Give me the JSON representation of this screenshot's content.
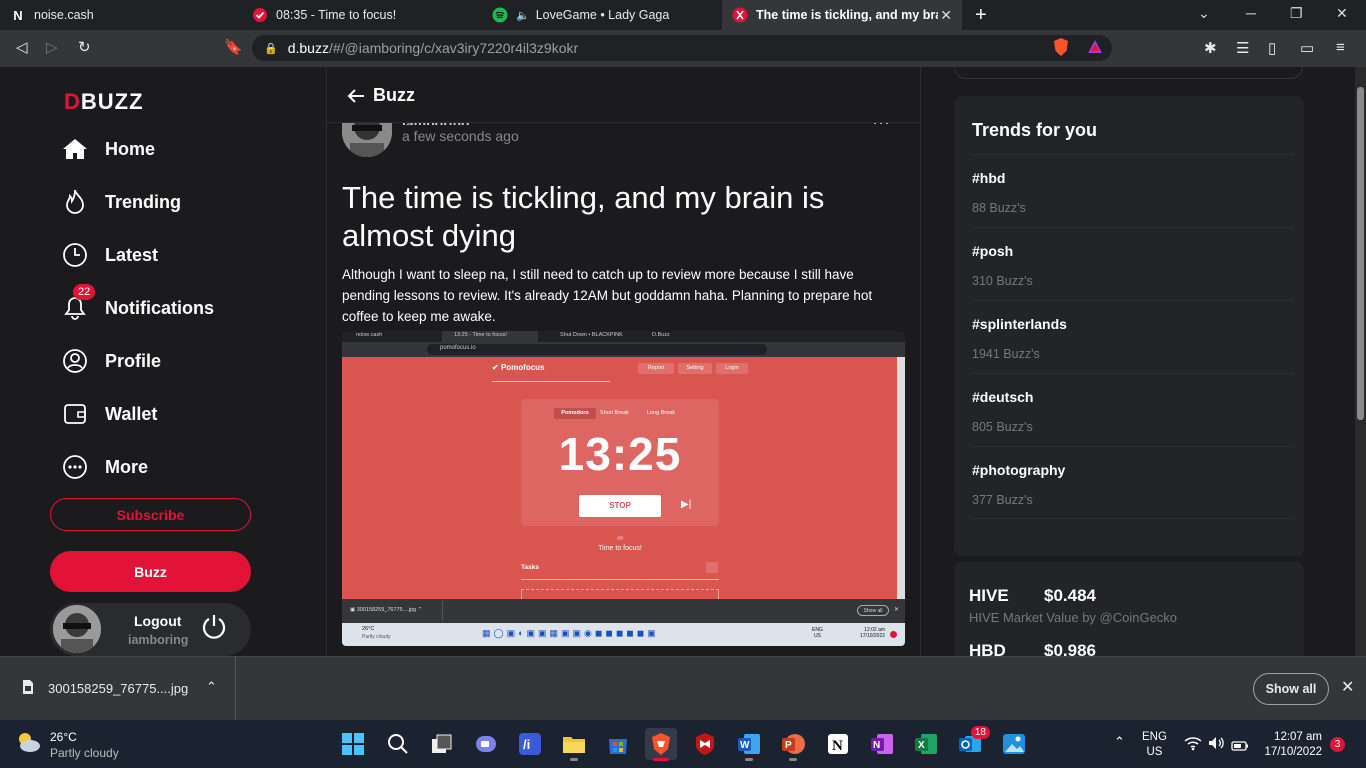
{
  "browser": {
    "tabs": [
      {
        "title": "noise.cash",
        "icon": "noise-cash-icon"
      },
      {
        "title": "08:35 - Time to focus!",
        "icon": "pomofocus-icon"
      },
      {
        "title": "LoveGame • Lady Gaga",
        "icon": "spotify-icon"
      },
      {
        "title": "The time is tickling, and my brain",
        "icon": "dbuzz-icon"
      }
    ],
    "url_host": "d.buzz",
    "url_path": "/#/@iamboring/c/xav3iry7220r4il3z9kokr"
  },
  "sidebar": {
    "logo_d": "D",
    "logo_rest": "BUZZ",
    "nav": [
      {
        "label": "Home",
        "icon": "home-icon"
      },
      {
        "label": "Trending",
        "icon": "flame-icon"
      },
      {
        "label": "Latest",
        "icon": "clock-icon"
      },
      {
        "label": "Notifications",
        "icon": "bell-icon",
        "badge": "22"
      },
      {
        "label": "Profile",
        "icon": "user-icon"
      },
      {
        "label": "Wallet",
        "icon": "wallet-icon"
      },
      {
        "label": "More",
        "icon": "more-icon"
      }
    ],
    "subscribe_label": "Subscribe",
    "buzz_label": "Buzz",
    "logout_label": "Logout",
    "username": "iamboring"
  },
  "post": {
    "header": "Buzz",
    "author": "iamboring",
    "time": "a few seconds ago",
    "title": "The time is tickling, and my brain is almost dying",
    "body": "Although I want to sleep na, I still need to catch up to review more because I still have pending lessons to review. It's already 12AM but goddamn haha. Planning to prepare hot coffee to keep me awake.",
    "image": {
      "tabs": [
        "noise.cash",
        "13:25 - Time to focus!",
        "Shut Down • BLACKPINK",
        "D.Buzz"
      ],
      "url": "pomofocus.io",
      "app_name": "Pomofocus",
      "buttons": [
        "Report",
        "Setting",
        "Login"
      ],
      "modes": [
        "Pomodoro",
        "Short Break",
        "Long Break"
      ],
      "timer": "13:25",
      "stop_label": "STOP",
      "session": "#8",
      "session_text": "Time to focus!",
      "tasks_label": "Tasks",
      "download_name": "300158259_76775....jpg",
      "show_all": "Show all",
      "weather_temp": "26°C",
      "weather_desc": "Partly cloudy",
      "lang": "ENG",
      "lang2": "US",
      "time": "12:02 am",
      "date": "17/10/2022"
    }
  },
  "trends": {
    "title": "Trends for you",
    "items": [
      {
        "tag": "#hbd",
        "count": "88 Buzz's"
      },
      {
        "tag": "#posh",
        "count": "310 Buzz's"
      },
      {
        "tag": "#splinterlands",
        "count": "1941 Buzz's"
      },
      {
        "tag": "#deutsch",
        "count": "805 Buzz's"
      },
      {
        "tag": "#photography",
        "count": "377 Buzz's"
      }
    ]
  },
  "market": {
    "hive_label": "HIVE",
    "hive_value": "$0.484",
    "subtitle": "HIVE Market Value by @CoinGecko",
    "hbd_label": "HBD",
    "hbd_value": "$0.986"
  },
  "download": {
    "filename": "300158259_76775....jpg",
    "show_all": "Show all"
  },
  "taskbar": {
    "weather_temp": "26°C",
    "weather_desc": "Partly cloudy",
    "lang": "ENG",
    "region": "US",
    "time": "12:07 am",
    "date": "17/10/2022",
    "notif_count": "3",
    "outlook_badge": "18"
  },
  "colors": {
    "accent": "#e31337",
    "bg": "#1b1b1e",
    "card": "#232427",
    "pomodoro": "#d95550"
  }
}
